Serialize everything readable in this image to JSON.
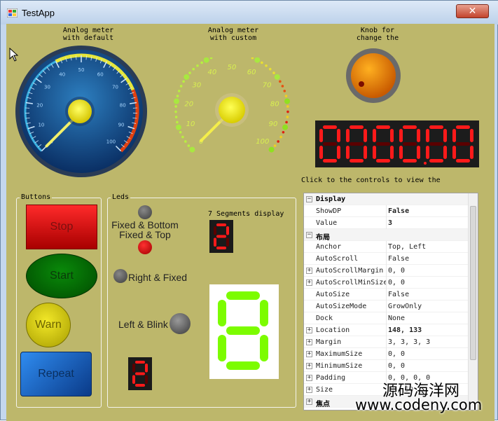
{
  "window": {
    "title": "TestApp",
    "close_glyph": "✕"
  },
  "meters": {
    "default_label": "Analog meter\nwith default",
    "custom_label": "Analog meter\nwith custom",
    "knob_label": "Knob for\nchange the",
    "default_ticks": [
      "0",
      "10",
      "20",
      "30",
      "40",
      "50",
      "60",
      "70",
      "80",
      "90",
      "100"
    ],
    "custom_ticks": [
      "0",
      "10",
      "20",
      "30",
      "40",
      "50",
      "60",
      "70",
      "80",
      "90",
      "100"
    ],
    "default_value": 0,
    "custom_value": 0
  },
  "display": {
    "digits": "000000",
    "hint": "Click to the controls to view the"
  },
  "buttons": {
    "group_title": "Buttons",
    "stop": "Stop",
    "start": "Start",
    "warn": "Warn",
    "repeat": "Repeat"
  },
  "leds": {
    "group_title": "Leds",
    "fixed_bottom": "Fixed & Bottom",
    "fixed_top": "Fixed & Top",
    "right_fixed": "Right & Fixed",
    "left_blink": "Left & Blink",
    "seg_title": "7 Segments display",
    "seg_small_1": "2",
    "seg_small_2": "2",
    "seg_big": "8"
  },
  "propertygrid": {
    "rows": [
      {
        "type": "cat",
        "expander": "⊟",
        "name": "Display"
      },
      {
        "type": "prop",
        "name": "ShowDP",
        "value": "False",
        "bold": true
      },
      {
        "type": "prop",
        "name": "Value",
        "value": "3",
        "bold": true
      },
      {
        "type": "cat",
        "expander": "⊟",
        "name": "布局"
      },
      {
        "type": "prop",
        "name": "Anchor",
        "value": "Top, Left"
      },
      {
        "type": "prop",
        "name": "AutoScroll",
        "value": "False"
      },
      {
        "type": "prop",
        "expander": "+",
        "name": "AutoScrollMargin",
        "value": "0, 0"
      },
      {
        "type": "prop",
        "expander": "+",
        "name": "AutoScrollMinSize",
        "value": "0, 0"
      },
      {
        "type": "prop",
        "name": "AutoSize",
        "value": "False"
      },
      {
        "type": "prop",
        "name": "AutoSizeMode",
        "value": "GrowOnly"
      },
      {
        "type": "prop",
        "name": "Dock",
        "value": "None"
      },
      {
        "type": "prop",
        "expander": "+",
        "name": "Location",
        "value": "148, 133",
        "bold": true
      },
      {
        "type": "prop",
        "expander": "+",
        "name": "Margin",
        "value": "3, 3, 3, 3"
      },
      {
        "type": "prop",
        "expander": "+",
        "name": "MaximumSize",
        "value": "0, 0"
      },
      {
        "type": "prop",
        "expander": "+",
        "name": "MinimumSize",
        "value": "0, 0"
      },
      {
        "type": "prop",
        "expander": "+",
        "name": "Padding",
        "value": "0, 0, 0, 0"
      },
      {
        "type": "prop",
        "expander": "+",
        "name": "Size",
        "value": "38, 50"
      },
      {
        "type": "cat",
        "expander": "+",
        "name": "焦点"
      }
    ]
  },
  "watermark": {
    "line1": "源码海洋网",
    "line2": "www.codeny.com"
  },
  "colors": {
    "client_bg": "#bdb76b",
    "seg_on": "#ff1a1a",
    "seg_off": "#5a0000",
    "big_seg_on": "#7cfc00",
    "big_seg_off": "#d4f7b8"
  },
  "icons": {
    "app": "app-icon",
    "close": "close-icon",
    "cursor": "mouse-pointer-icon"
  }
}
